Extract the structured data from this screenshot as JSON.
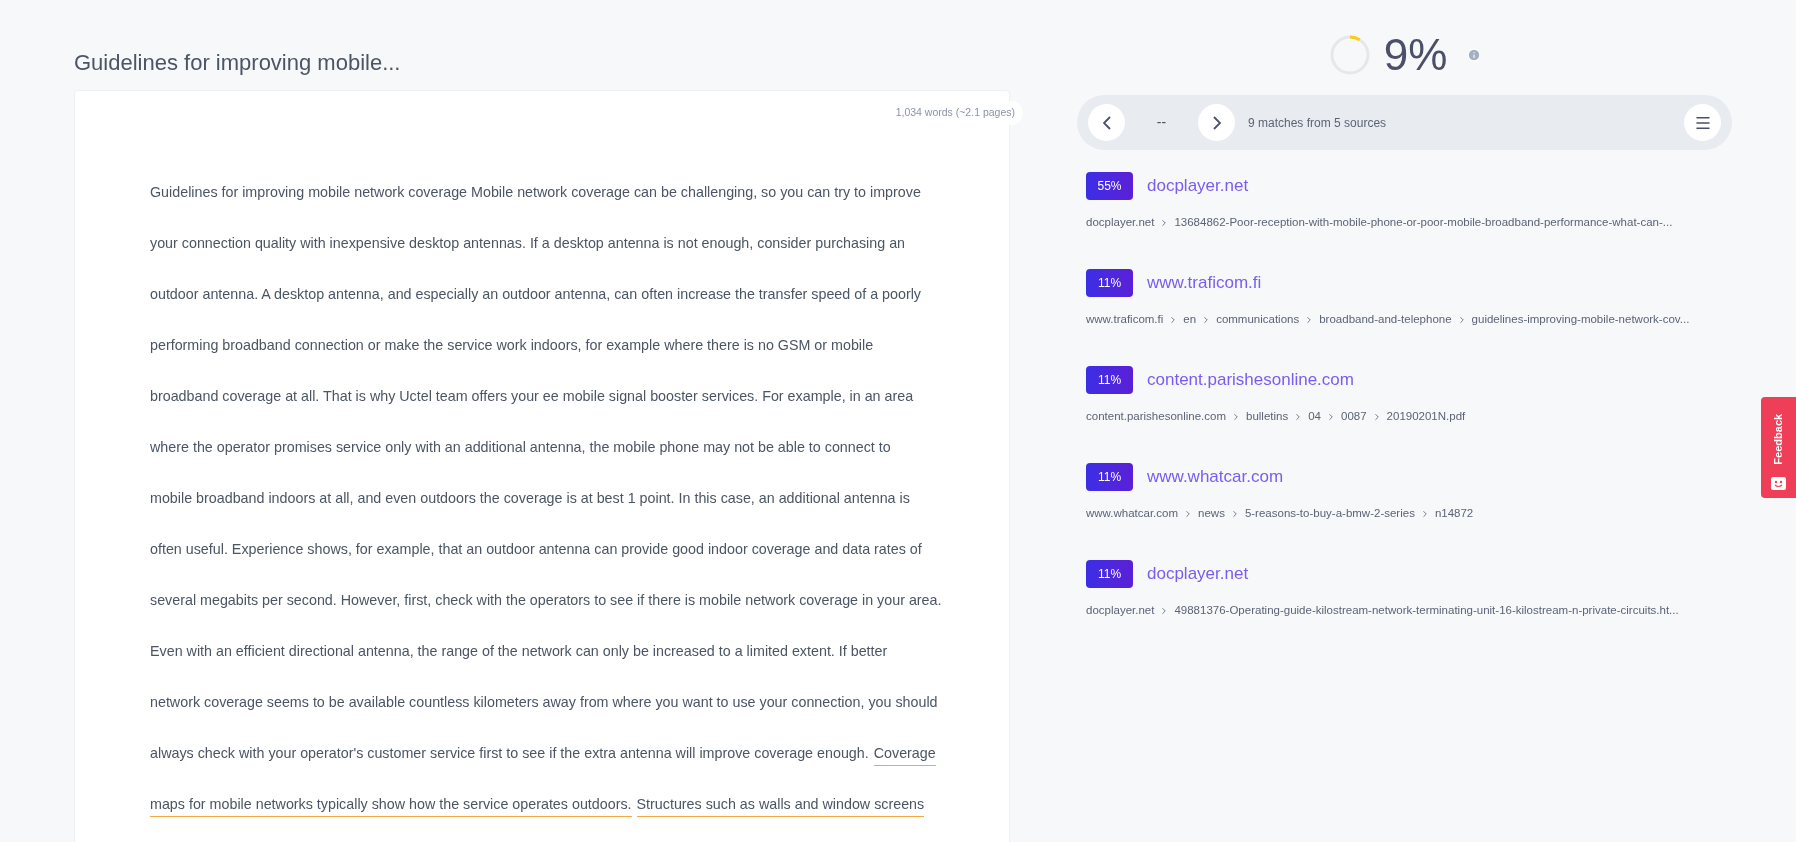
{
  "document": {
    "title": "Guidelines for improving mobile...",
    "word_count": "1,034 words (~2.1 pages)",
    "lines": [
      [
        {
          "text": "Guidelines for improving mobile network coverage Mobile network coverage can be challenging, so you can try to improve",
          "matched": false
        }
      ],
      [
        {
          "text": "your connection quality with inexpensive desktop antennas. If a desktop antenna is not enough, consider purchasing an",
          "matched": false
        }
      ],
      [
        {
          "text": "outdoor antenna. A desktop antenna, and especially an outdoor antenna, can often increase the transfer speed of a poorly",
          "matched": false
        }
      ],
      [
        {
          "text": "performing broadband connection or make the service work indoors, for example where there is no GSM or mobile",
          "matched": false
        }
      ],
      [
        {
          "text": "broadband coverage at all. That is why Uctel team offers your ee mobile signal booster services. For example, in an area",
          "matched": false
        }
      ],
      [
        {
          "text": "where the operator promises service only with an additional antenna, the mobile phone may not be able to connect to",
          "matched": false
        }
      ],
      [
        {
          "text": "mobile broadband indoors at all, and even outdoors the coverage is at best 1 point. In this case, an additional antenna is",
          "matched": false
        }
      ],
      [
        {
          "text": "often useful. Experience shows, for example, that an outdoor antenna can provide good indoor coverage and data rates of",
          "matched": false
        }
      ],
      [
        {
          "text": "several megabits per second. However, first, check with the operators to see if there is mobile network coverage in your area.",
          "matched": false
        }
      ],
      [
        {
          "text": "Even with an efficient directional antenna, the range of the network can only be increased to a limited extent. If better",
          "matched": false
        }
      ],
      [
        {
          "text": "network coverage seems to be available countless kilometers away from where you want to use your connection, you should",
          "matched": false
        }
      ],
      [
        {
          "text": "always check with your operator's customer service first to see if the extra antenna will improve coverage enough.",
          "matched": false
        },
        {
          "text": "Coverage",
          "matched": true
        }
      ],
      [
        {
          "text": "maps for mobile networks typically show how the service operates outdoors.",
          "matched": true
        },
        {
          "text": "Structures such as walls and window screens",
          "matched": true
        }
      ]
    ]
  },
  "score": {
    "value": "9%",
    "level": 0.09
  },
  "toolbar": {
    "position": "--",
    "summary": "9 matches from 5 sources"
  },
  "sources": [
    {
      "percent": "55%",
      "domain": "docplayer.net",
      "path": [
        "docplayer.net",
        "13684862-Poor-reception-with-mobile-phone-or-poor-mobile-broadband-performance-what-can-..."
      ]
    },
    {
      "percent": "11%",
      "domain": "www.traficom.fi",
      "path": [
        "www.traficom.fi",
        "en",
        "communications",
        "broadband-and-telephone",
        "guidelines-improving-mobile-network-cov..."
      ]
    },
    {
      "percent": "11%",
      "domain": "content.parishesonline.com",
      "path": [
        "content.parishesonline.com",
        "bulletins",
        "04",
        "0087",
        "20190201N.pdf"
      ]
    },
    {
      "percent": "11%",
      "domain": "www.whatcar.com",
      "path": [
        "www.whatcar.com",
        "news",
        "5-reasons-to-buy-a-bmw-2-series",
        "n14872"
      ]
    },
    {
      "percent": "11%",
      "domain": "docplayer.net",
      "path": [
        "docplayer.net",
        "49881376-Operating-guide-kilostream-network-terminating-unit-16-kilostream-n-private-circuits.ht..."
      ]
    }
  ],
  "feedback": {
    "label": "Feedback"
  }
}
